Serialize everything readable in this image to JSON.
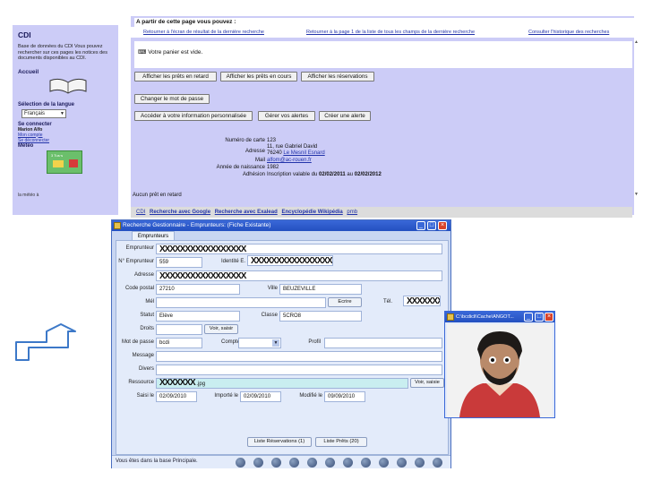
{
  "portal": {
    "left": {
      "title": "CDI",
      "description": "Base de données du CDI Vous pouvez rechercher sur ces pages les notices des documents disponibles au CDI.",
      "home": "Accueil",
      "lang_label": "Sélection de la langue",
      "lang_value": "Français",
      "login_title": "Se connecter",
      "user_name": "Marion Alfo",
      "my_account": "Mon compte",
      "logout": "Se déconnecter",
      "weather_title": "Météo",
      "weather_badge": "3 Tus·s",
      "weather_link": "la météo à"
    },
    "main": {
      "intro": "A partir de cette page vous pouvez :",
      "links": [
        "Retourner à l'écran de résultat de la dernière recherche",
        "Retourner à la page 1 de la liste de tous les champs de la dernière recherche",
        "Consulter l'historique des recherches"
      ],
      "cart": "Votre panier est vide.",
      "buttons_row1": [
        "Afficher les prêts en retard",
        "Afficher les prêts en cours",
        "Afficher les réservations"
      ],
      "change_password": "Changer le mot de passe",
      "buttons_row3": [
        "Accéder à votre information personnalisée",
        "Gérer vos alertes",
        "Créer une alerte"
      ],
      "info": {
        "card_label": "Numéro de carte",
        "card_value": "123",
        "address_label": "Adresse",
        "address_line1": "11, rue Gabriel David",
        "address_line2_zip": "76240",
        "address_line2_city": "Le Mesnil Esnard",
        "mail_label": "Mail",
        "mail_value": "alfom@ac-rouen.fr",
        "birth_label": "Année de naissance",
        "birth_value": "1982",
        "membership_label": "Adhésion",
        "membership_text": "Inscription valable du",
        "membership_from": "02/02/2011",
        "membership_mid": "au",
        "membership_to": "02/02/2012"
      },
      "no_loan": "Aucun prêt en retard",
      "footer_links": [
        "CDI",
        "Recherche avec Google",
        "Recherche avec Exalead",
        "Encyclopédie Wikipédia",
        "pmb"
      ]
    }
  },
  "app": {
    "title": "Recherche Gestionnaire - Emprunteurs:  (Fiche Existante)",
    "tab": "Emprunteurs",
    "labels": {
      "emprunteur": "Emprunteur",
      "num": "N° Emprunteur",
      "identite": "Identité E.",
      "adresse": "Adresse",
      "cp": "Code postal",
      "ville": "Ville",
      "mel": "Mél",
      "tel": "Tél.",
      "statut": "Statut",
      "classe": "Classe",
      "droits": "Droits",
      "mdp": "Mot de passe",
      "compte": "Compte",
      "profil": "Profil",
      "message": "Message",
      "divers": "Divers",
      "ressource": "Ressource",
      "saisi": "Saisi le",
      "importe": "Importé le",
      "modifie": "Modifié le"
    },
    "values": {
      "emprunteur": "XXXXXXXXXXXXXXXXX",
      "num": "559",
      "identite": "XXXXXXXXXXXXXXXXX",
      "adresse": "XXXXXXXXXXXXXXXXX",
      "cp": "27210",
      "ville": "BEUZEVILLE",
      "tel": "XXXXXXX",
      "statut": "Elève",
      "classe": "5CRO8",
      "mdp": "bcdi",
      "ressource_mask": "XXXXXXX",
      "ressource_ext": ".jpg",
      "saisi": "02/09/2010",
      "importe": "02/09/2010",
      "modifie": "09/09/2010"
    },
    "buttons": {
      "ecrire": "Ecrire",
      "voir_saisir": "Voir, saisir",
      "voir_saisie": "Voir, saisie",
      "reservations": "Liste Réservations  (1)",
      "prets": "Liste Prêts  (20)"
    },
    "status": "Vous êtes dans la base Principale."
  },
  "photo_window": {
    "title": "C:\\bcdicli\\Cache\\ANGOT..."
  }
}
